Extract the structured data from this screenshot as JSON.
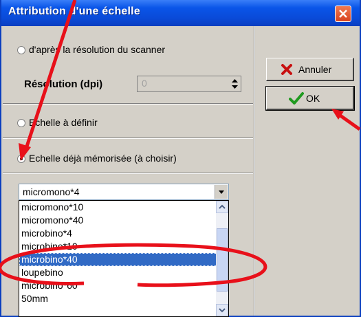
{
  "window": {
    "title": "Attribution d'une échelle"
  },
  "options": {
    "scanner_label": "d'après la résolution du scanner",
    "resolution_label": "Résolution (dpi)",
    "resolution_value": "0",
    "define_label": "Echelle à définir",
    "memorized_label": "Echelle déjà mémorisée (à choisir)",
    "selected": "memorized"
  },
  "buttons": {
    "cancel_label": "Annuler",
    "ok_label": "OK"
  },
  "combo": {
    "value": "micromono*4"
  },
  "list": {
    "items": [
      "micromono*10",
      "micromono*40",
      "microbino*4",
      "microbino*10",
      "microbino*40",
      "loupebino",
      "microbino*60",
      "50mm"
    ],
    "selected_index": 4
  },
  "colors": {
    "annotation": "#e8101a",
    "titlebar": "#0a55e8",
    "selection": "#316ac5"
  }
}
